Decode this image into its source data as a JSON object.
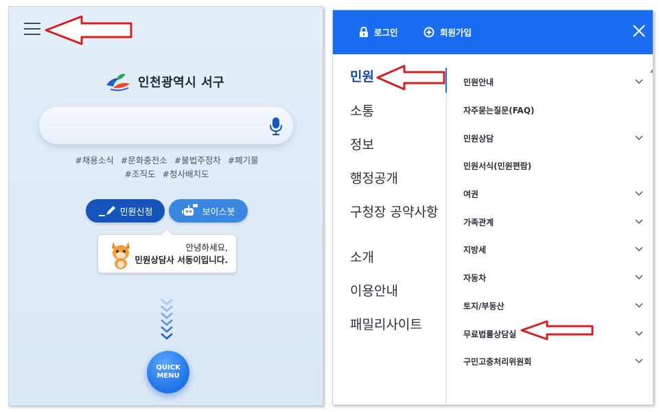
{
  "left": {
    "logo_text": "인천광역시 서구",
    "hashtags_line1": [
      "#채용소식",
      "#문화충전소",
      "#불법주정차",
      "#폐기물"
    ],
    "hashtags_line2": [
      "#조직도",
      "#청사배치도"
    ],
    "civil_button": "민원신청",
    "voicebot_button": "보이스봇",
    "greeting_line1": "안녕하세요,",
    "greeting_line2": "민원상담사 서동이입니다.",
    "quick_menu_line1": "QUICK",
    "quick_menu_line2": "MENU"
  },
  "right": {
    "login_label": "로그인",
    "signup_label": "회원가입",
    "categories": [
      "민원",
      "소통",
      "정보",
      "행정공개",
      "구청장 공약사항",
      "소개",
      "이용안내",
      "패밀리사이트"
    ],
    "sub_items": [
      "민원안내",
      "자주묻는질문(FAQ)",
      "민원상담",
      "민원서식(민원편람)",
      "여권",
      "가족관계",
      "지방세",
      "자동차",
      "토지/부동산",
      "무료법률상담실",
      "구민고충처리위원회"
    ]
  },
  "colors": {
    "accent_blue": "#1a6cf0",
    "active_category": "#1446a8",
    "arrow_red": "#d42020",
    "left_bg": "#e4eef9"
  },
  "icons": [
    "menu-icon",
    "logo-icon",
    "mic-icon",
    "pen-icon",
    "robot-icon",
    "mascot-icon",
    "chevron-down-icon",
    "lock-icon",
    "plus-circle-icon",
    "close-icon"
  ]
}
